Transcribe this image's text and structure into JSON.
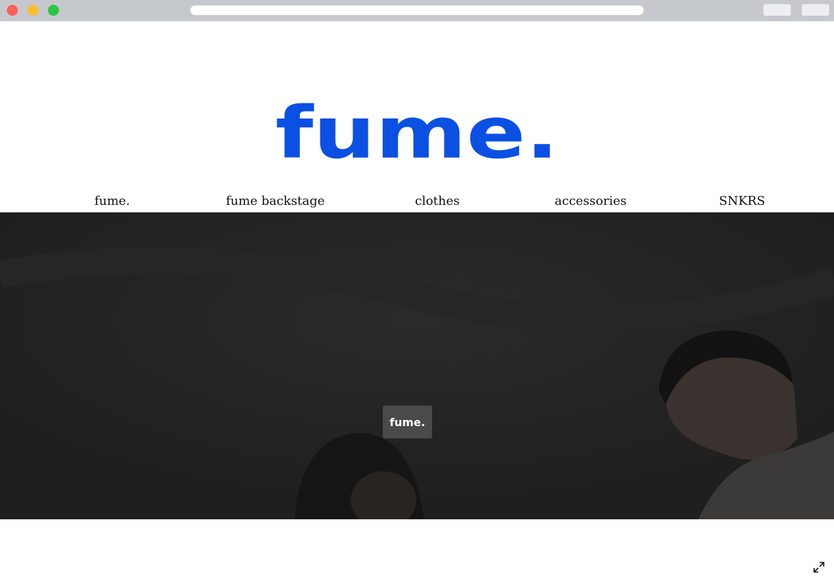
{
  "browser": {
    "window_controls": [
      "close",
      "minimize",
      "maximize"
    ],
    "url": ""
  },
  "header": {
    "logo_text": "fume.",
    "logo_color": "#0b50e3"
  },
  "nav": {
    "items": [
      {
        "label": "fume."
      },
      {
        "label": "fume backstage"
      },
      {
        "label": "clothes"
      },
      {
        "label": "accessories"
      },
      {
        "label": "SNKRS"
      }
    ]
  },
  "hero": {
    "badge_label": "fume.",
    "overlay_color": "#222222"
  },
  "controls": {
    "expand_icon": "expand-icon"
  }
}
